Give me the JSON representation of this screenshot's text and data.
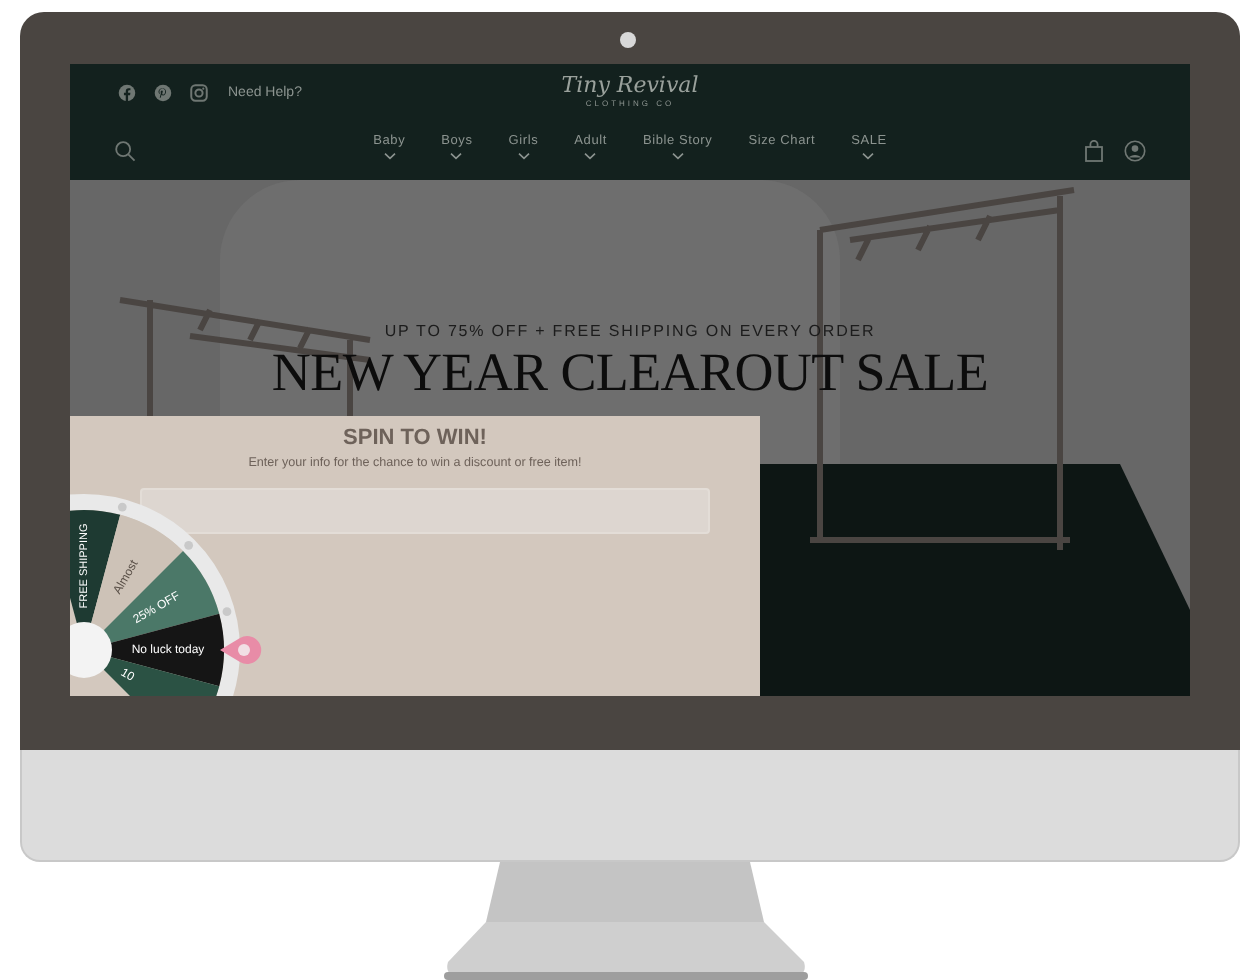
{
  "header": {
    "help_link": "Need Help?",
    "logo_title": "Tiny Revival",
    "logo_subtitle": "CLOTHING CO",
    "nav": [
      {
        "label": "Baby",
        "dropdown": true
      },
      {
        "label": "Boys",
        "dropdown": true
      },
      {
        "label": "Girls",
        "dropdown": true
      },
      {
        "label": "Adult",
        "dropdown": true
      },
      {
        "label": "Bible Story",
        "dropdown": true
      },
      {
        "label": "Size Chart",
        "dropdown": false
      },
      {
        "label": "SALE",
        "dropdown": true
      }
    ]
  },
  "hero": {
    "kicker": "UP TO 75% OFF + FREE SHIPPING ON EVERY ORDER",
    "headline": "NEW YEAR CLEAROUT SALE"
  },
  "popup": {
    "title": "SPIN TO WIN!",
    "subtitle": "Enter your info for the chance to win a discount or free item!",
    "wheel": [
      {
        "label": "FREE SHIPPING",
        "color": "#1e3a32"
      },
      {
        "label": "Almost",
        "color": "#cdc2b7"
      },
      {
        "label": "25% OFF",
        "color": "#4b7868"
      },
      {
        "label": "No luck today",
        "color": "#151515"
      },
      {
        "label": "10",
        "color": "#2b5244"
      }
    ]
  }
}
